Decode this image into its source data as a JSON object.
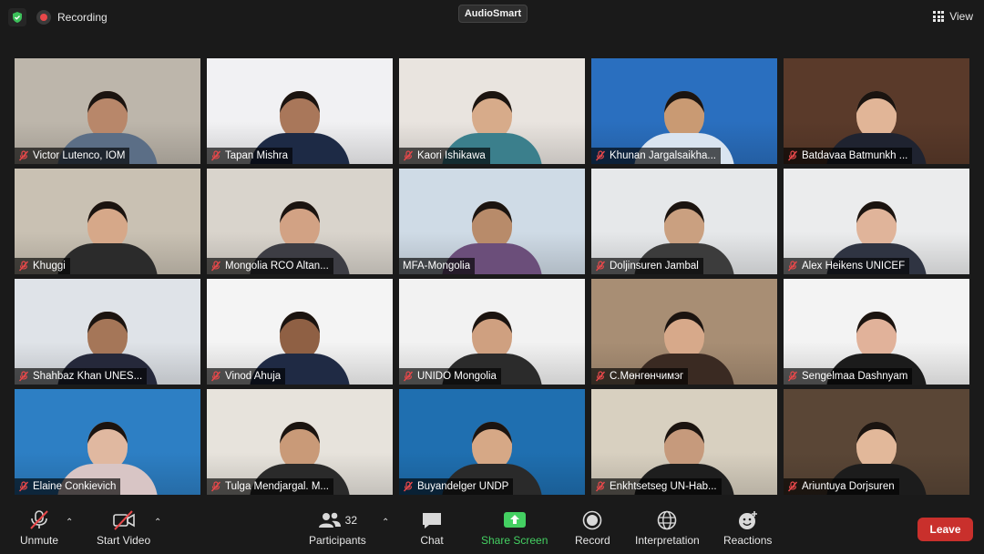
{
  "topbar": {
    "recording_label": "Recording",
    "brand": "AudioSmart",
    "view_label": "View"
  },
  "participants": [
    {
      "name": "Victor Lutenco, IOM",
      "bg": "#bdb6ab",
      "skin": "#b8876a",
      "shirt": "#5b6e86"
    },
    {
      "name": "Tapan Mishra",
      "bg": "#f1f1f3",
      "skin": "#a9775a",
      "shirt": "#1d2a45"
    },
    {
      "name": "Kaori Ishikawa",
      "bg": "#e9e4df",
      "skin": "#d7ab8a",
      "shirt": "#3b7f8c"
    },
    {
      "name": "Khunan Jargalsaikha...",
      "bg": "#2a6fbf",
      "skin": "#c99a73",
      "shirt": "#d9e4f0"
    },
    {
      "name": "Batdavaa Batmunkh ...",
      "bg": "#5a3a2a",
      "skin": "#e1b597",
      "shirt": "#1f2330"
    },
    {
      "name": "Khuggi",
      "bg": "#c9c1b3",
      "skin": "#d6a889",
      "shirt": "#2b2b2b"
    },
    {
      "name": "Mongolia RCO Altan...",
      "bg": "#d9d4cc",
      "skin": "#d2a284",
      "shirt": "#3d3d44"
    },
    {
      "name": "MFA-Mongolia",
      "bg": "#cfdbe6",
      "skin": "#b88b6a",
      "shirt": "#6b4e7a"
    },
    {
      "name": "Doljinsuren Jambal",
      "bg": "#e6e8ea",
      "skin": "#caa080",
      "shirt": "#3c3c3c"
    },
    {
      "name": "Alex Heikens UNICEF",
      "bg": "#ebeced",
      "skin": "#e0b49a",
      "shirt": "#2f3442"
    },
    {
      "name": "Shahbaz Khan UNES...",
      "bg": "#dfe3e8",
      "skin": "#a57658",
      "shirt": "#25283a"
    },
    {
      "name": "Vinod Ahuja",
      "bg": "#f4f4f4",
      "skin": "#8f6044",
      "shirt": "#1f2a44"
    },
    {
      "name": "UNIDO Mongolia",
      "bg": "#f2f2f2",
      "skin": "#cfa080",
      "shirt": "#2b2b2b"
    },
    {
      "name": "С.Мөнгөнчимэг",
      "bg": "#a88e74",
      "skin": "#d7a98a",
      "shirt": "#3a2a22"
    },
    {
      "name": "Sengelmaa Dashnyam",
      "bg": "#f3f3f3",
      "skin": "#e1b29a",
      "shirt": "#1b1b1b"
    },
    {
      "name": "Elaine Conkievich",
      "bg": "#2d7fc4",
      "skin": "#e0b8a0",
      "shirt": "#d8c5c5"
    },
    {
      "name": "Tulga Mendjargal. M...",
      "bg": "#e7e3dc",
      "skin": "#c99a78",
      "shirt": "#2a2a2a"
    },
    {
      "name": "Buyandelger UNDP",
      "bg": "#1f6fb0",
      "skin": "#d6a886",
      "shirt": "#2a2a2a"
    },
    {
      "name": "Enkhtsetseg UN-Hab...",
      "bg": "#d8d0c0",
      "skin": "#c69a7c",
      "shirt": "#1e1e1e"
    },
    {
      "name": "Ariuntuya Dorjsuren",
      "bg": "#5a4636",
      "skin": "#e2b89a",
      "shirt": "#1c1c1c"
    }
  ],
  "toolbar": {
    "unmute": "Unmute",
    "start_video": "Start Video",
    "participants": "Participants",
    "participant_count": "32",
    "chat": "Chat",
    "share_screen": "Share Screen",
    "record": "Record",
    "interpretation": "Interpretation",
    "reactions": "Reactions",
    "leave": "Leave"
  },
  "colors": {
    "accent_share": "#44d062",
    "leave_red": "#c9302c",
    "active_speaker": "#c7d64a",
    "muted_red": "#e8484a"
  },
  "icons": [
    "shield-icon",
    "record-dot-icon",
    "grid-view-icon",
    "mic-off-icon",
    "video-off-icon",
    "participants-icon",
    "chat-icon",
    "share-screen-icon",
    "record-icon",
    "globe-icon",
    "reactions-icon",
    "caret-up-icon"
  ]
}
